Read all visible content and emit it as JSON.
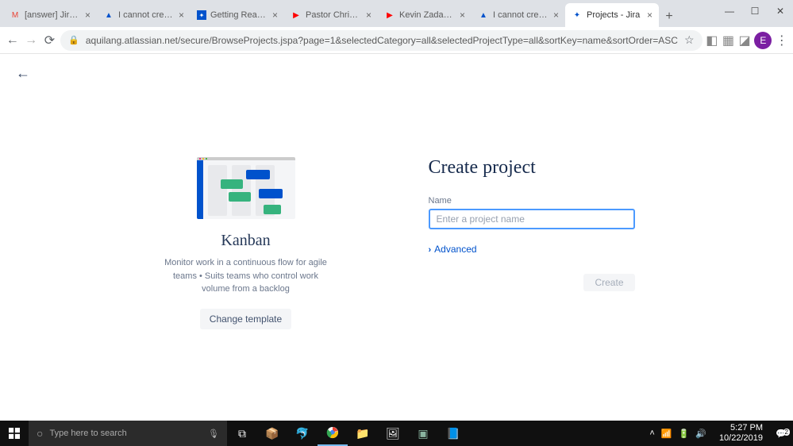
{
  "browser": {
    "tabs": [
      {
        "favicon": "gmail",
        "title": "[answer] Jira Serv"
      },
      {
        "favicon": "atlassian",
        "title": "I cannot create a n"
      },
      {
        "favicon": "jira-blue",
        "title": "Getting Ready for"
      },
      {
        "favicon": "youtube",
        "title": "Pastor Chriss Desi"
      },
      {
        "favicon": "youtube",
        "title": "Kevin Zadai - YouT"
      },
      {
        "favicon": "atlassian",
        "title": "I cannot create a n"
      },
      {
        "favicon": "jira",
        "title": "Projects - Jira",
        "active": true
      }
    ],
    "url": "aquilang.atlassian.net/secure/BrowseProjects.jspa?page=1&selectedCategory=all&selectedProjectType=all&sortKey=name&sortOrder=ASC",
    "avatar_letter": "E"
  },
  "template": {
    "title": "Kanban",
    "description": "Monitor work in a continuous flow for agile teams • Suits teams who control work volume from a backlog",
    "change_label": "Change template"
  },
  "form": {
    "heading": "Create project",
    "name_label": "Name",
    "name_placeholder": "Enter a project name",
    "name_value": "",
    "advanced_label": "Advanced",
    "create_label": "Create"
  },
  "taskbar": {
    "search_placeholder": "Type here to search",
    "time": "5:27 PM",
    "date": "10/22/2019",
    "notif_count": "2"
  }
}
